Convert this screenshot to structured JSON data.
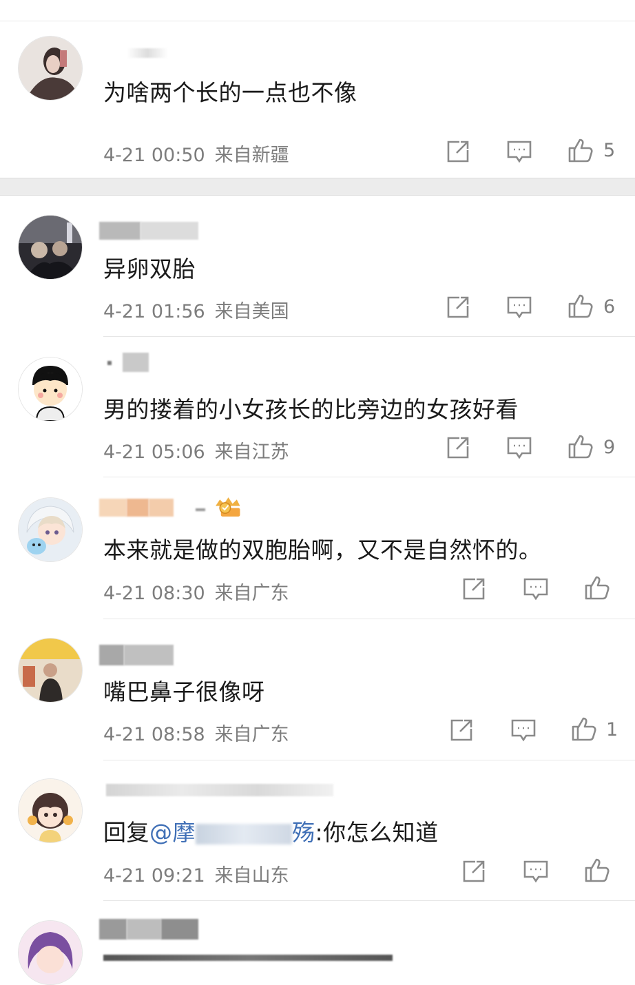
{
  "colors": {
    "text": "#1a1a1a",
    "meta": "#7d7d7d",
    "mention": "#3f6fb6",
    "separator": "#ececec"
  },
  "icons": {
    "share": "share-icon",
    "reply": "comment-icon",
    "like": "thumbs-up-icon"
  },
  "comments": [
    {
      "text": "为啥两个长的一点也不像",
      "time": "4-21 00:50",
      "location": "来自新疆",
      "likes": "5"
    },
    {
      "text": "异卵双胎",
      "time": "4-21 01:56",
      "location": "来自美国",
      "likes": "6"
    },
    {
      "text": "男的搂着的小女孩长的比旁边的女孩好看",
      "time": "4-21 05:06",
      "location": "来自江苏",
      "likes": "9"
    },
    {
      "text": "本来就是做的双胞胎啊，又不是自然怀的。",
      "time": "4-21 08:30",
      "location": "来自广东",
      "likes": ""
    },
    {
      "text": "嘴巴鼻子很像呀",
      "time": "4-21 08:58",
      "location": "来自广东",
      "likes": "1"
    },
    {
      "text_prefix": "回复",
      "mention_start": "@摩",
      "mention_end": "殇",
      "text_suffix": ":你怎么知道",
      "time": "4-21 09:21",
      "location": "来自山东",
      "likes": ""
    }
  ]
}
